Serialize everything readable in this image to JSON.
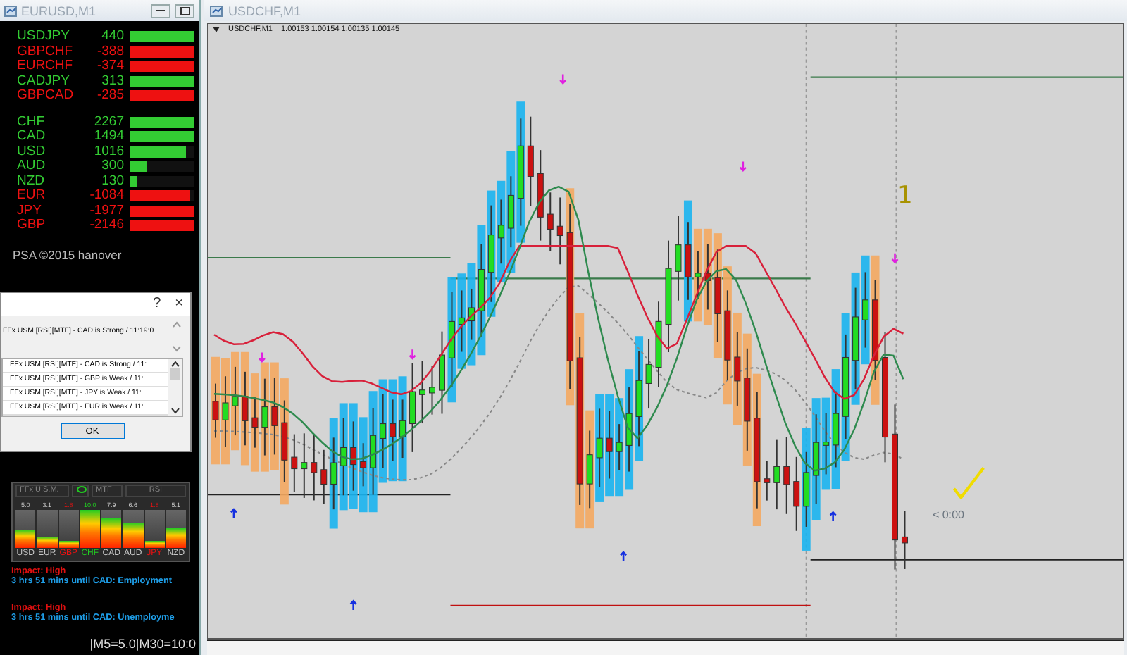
{
  "left_window": {
    "title": "EURUSD,M1",
    "pairs": [
      {
        "name": "USDJPY",
        "value": "440",
        "level": 1,
        "color": "#33cc33"
      },
      {
        "name": "GBPCHF",
        "value": "-388",
        "level": 1,
        "color": "#ee1111"
      },
      {
        "name": "EURCHF",
        "value": "-374",
        "level": 1,
        "color": "#ee1111"
      },
      {
        "name": "CADJPY",
        "value": "313",
        "level": 1,
        "color": "#33cc33"
      },
      {
        "name": "GBPCAD",
        "value": "-285",
        "level": 1,
        "color": "#ee1111"
      }
    ],
    "currencies": [
      {
        "name": "CHF",
        "value": "2267",
        "level": 1,
        "color": "#33cc33"
      },
      {
        "name": "CAD",
        "value": "1494",
        "level": 1,
        "color": "#33cc33"
      },
      {
        "name": "USD",
        "value": "1016",
        "level": 0.86,
        "color": "#33cc33"
      },
      {
        "name": "AUD",
        "value": "300",
        "level": 0.25,
        "color": "#33cc33"
      },
      {
        "name": "NZD",
        "value": "130",
        "level": 0.1,
        "color": "#33cc33"
      },
      {
        "name": "EUR",
        "value": "-1084",
        "level": 0.94,
        "color": "#ee1111"
      },
      {
        "name": "JPY",
        "value": "-1977",
        "level": 1,
        "color": "#ee1111"
      },
      {
        "name": "GBP",
        "value": "-2146",
        "level": 1,
        "color": "#ee1111"
      }
    ],
    "credit": "PSA ©2015 hanover"
  },
  "dialog": {
    "help": "?",
    "close": "×",
    "message": "FFx USM [RSI][MTF] - CAD is Strong / 11:19:0",
    "alerts": [
      "FFx USM [RSI][MTF] - CAD is Strong / 11:...",
      "FFx USM [RSI][MTF] - GBP is Weak / 11:...",
      "FFx USM [RSI][MTF] - JPY is Weak / 11:...",
      "FFx USM [RSI][MTF] - EUR is Weak / 11:..."
    ],
    "button": "OK"
  },
  "meter": {
    "title": "FFx U.S.M.",
    "mode": "MTF",
    "indicator": "RSI",
    "columns": [
      {
        "currency": "USD",
        "reading": "5.0",
        "level": 0.5,
        "color": "#c8c8c8"
      },
      {
        "currency": "EUR",
        "reading": "3.1",
        "level": 0.31,
        "color": "#c8c8c8"
      },
      {
        "currency": "GBP",
        "reading": "1.8",
        "level": 0.18,
        "color": "#ee1111"
      },
      {
        "currency": "CHF",
        "reading": "10.0",
        "level": 1,
        "color": "#22cc22"
      },
      {
        "currency": "CAD",
        "reading": "7.9",
        "level": 0.79,
        "color": "#c8c8c8"
      },
      {
        "currency": "AUD",
        "reading": "6.6",
        "level": 0.66,
        "color": "#c8c8c8"
      },
      {
        "currency": "JPY",
        "reading": "1.8",
        "level": 0.18,
        "color": "#ee1111"
      },
      {
        "currency": "NZD",
        "reading": "5.1",
        "level": 0.51,
        "color": "#c8c8c8"
      }
    ]
  },
  "news": [
    {
      "impact": "Impact: High",
      "countdown": "3 hrs 51 mins until CAD: Employment"
    },
    {
      "impact": "Impact: High",
      "countdown": "3 hrs 51 mins until CAD: Unemployme"
    }
  ],
  "timeframes": "|M5=5.0|M30=10:0",
  "chart_window": {
    "title": "USDCHF,M1",
    "symbol": "USDCHF,M1",
    "quote": "1.00153 1.00154 1.00135 1.00145",
    "annotation": "1",
    "timer": "< 0:00"
  }
}
